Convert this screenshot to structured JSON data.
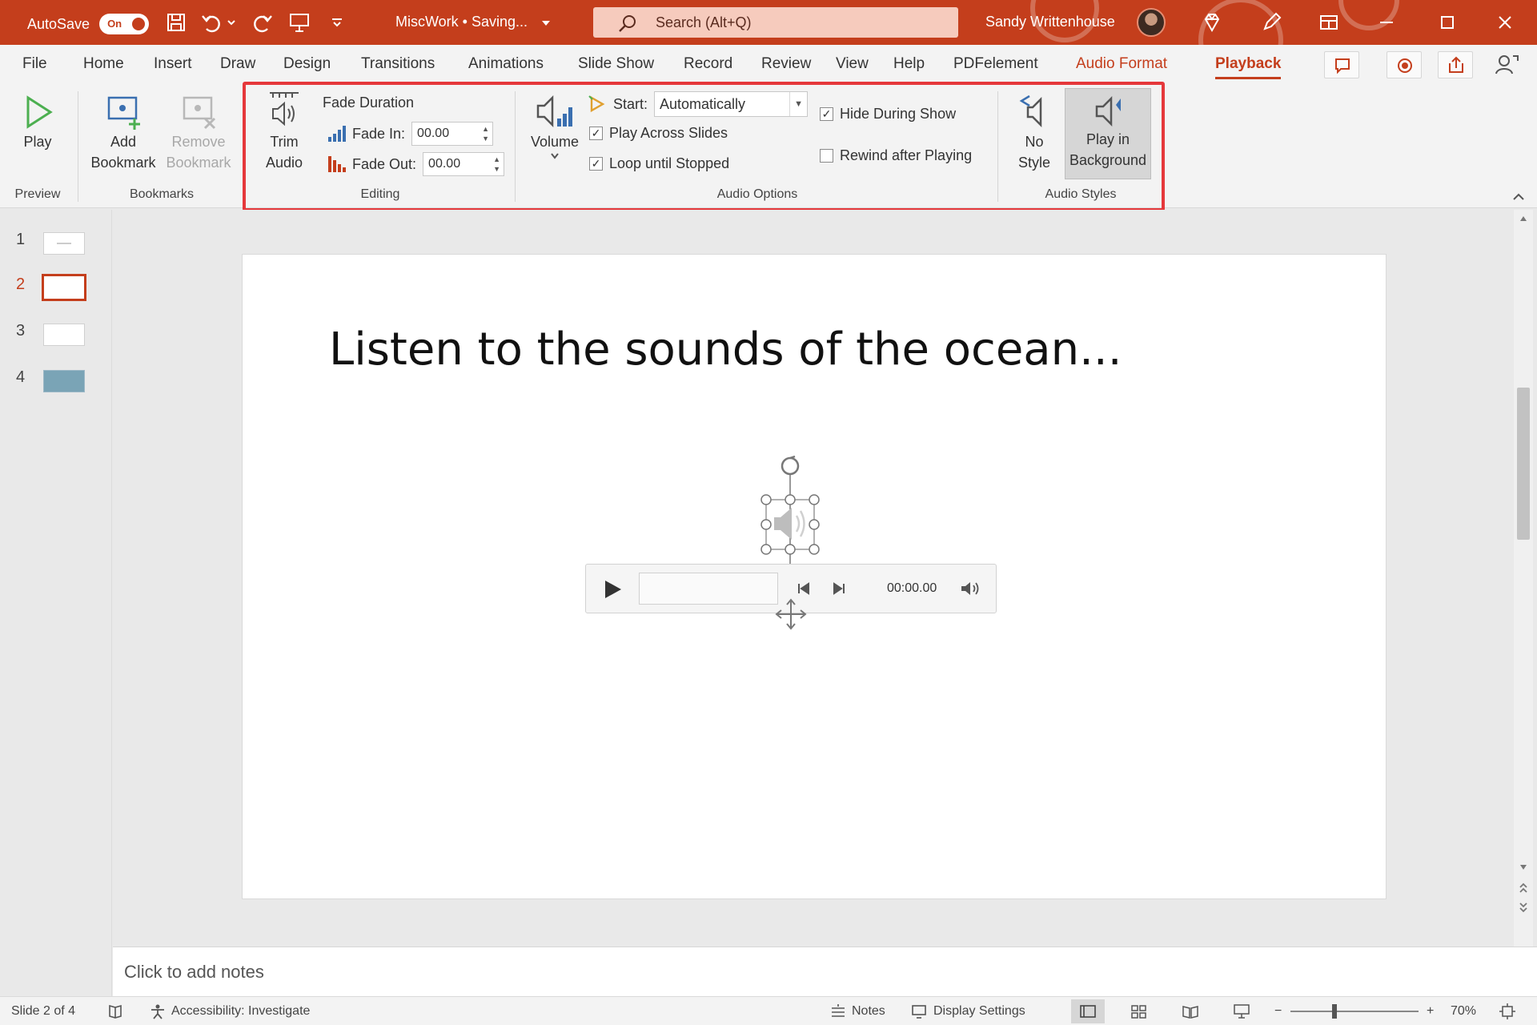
{
  "titlebar": {
    "autosave_label": "AutoSave",
    "autosave_state": "On",
    "doc_title": "MiscWork • Saving...",
    "search_placeholder": "Search (Alt+Q)",
    "user_name": "Sandy Writtenhouse"
  },
  "tabs": [
    "File",
    "Home",
    "Insert",
    "Draw",
    "Design",
    "Transitions",
    "Animations",
    "Slide Show",
    "Record",
    "Review",
    "View",
    "Help",
    "PDFelement",
    "Audio Format",
    "Playback"
  ],
  "active_tab": "Playback",
  "ribbon": {
    "preview": {
      "play": "Play",
      "group": "Preview"
    },
    "bookmarks": {
      "add_1": "Add",
      "add_2": "Bookmark",
      "remove_1": "Remove",
      "remove_2": "Bookmark",
      "group": "Bookmarks"
    },
    "editing": {
      "trim_1": "Trim",
      "trim_2": "Audio",
      "fade_duration": "Fade Duration",
      "fade_in_label": "Fade In:",
      "fade_in_value": "00.00",
      "fade_out_label": "Fade Out:",
      "fade_out_value": "00.00",
      "group": "Editing"
    },
    "audio_options": {
      "volume": "Volume",
      "start_label": "Start:",
      "start_value": "Automatically",
      "play_across_slides": "Play Across Slides",
      "play_across_slides_checked": true,
      "loop_until_stopped": "Loop until Stopped",
      "loop_until_stopped_checked": true,
      "hide_during_show": "Hide During Show",
      "hide_during_show_checked": true,
      "rewind_after_playing": "Rewind after Playing",
      "rewind_after_playing_checked": false,
      "group": "Audio Options"
    },
    "audio_styles": {
      "no_style_1": "No",
      "no_style_2": "Style",
      "play_bg_1": "Play in",
      "play_bg_2": "Background",
      "group": "Audio Styles"
    }
  },
  "thumbnails": [
    "1",
    "2",
    "3",
    "4"
  ],
  "current_slide_index": 2,
  "slide": {
    "title": "Listen to the sounds of the ocean...",
    "player_time": "00:00.00"
  },
  "notes_placeholder": "Click to add notes",
  "status": {
    "slide_count": "Slide 2 of 4",
    "accessibility": "Accessibility: Investigate",
    "notes": "Notes",
    "display_settings": "Display Settings",
    "zoom": "70%"
  },
  "colors": {
    "accent": "#c43e1c",
    "highlight": "#e5383b"
  }
}
